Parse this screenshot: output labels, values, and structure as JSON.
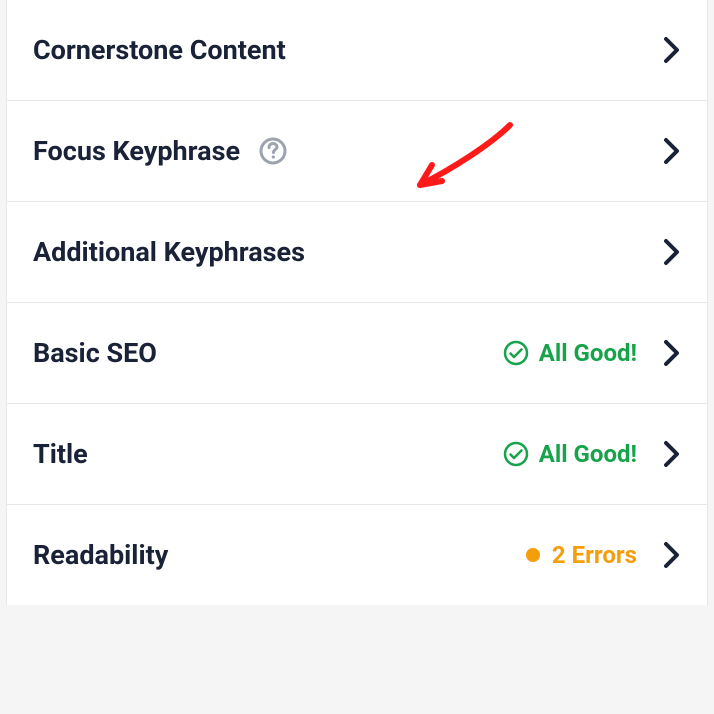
{
  "items": [
    {
      "label": "Cornerstone Content",
      "has_help": false
    },
    {
      "label": "Focus Keyphrase",
      "has_help": true
    },
    {
      "label": "Additional Keyphrases",
      "has_help": false
    },
    {
      "label": "Basic SEO",
      "has_help": false,
      "status": {
        "type": "good",
        "text": "All Good!"
      }
    },
    {
      "label": "Title",
      "has_help": false,
      "status": {
        "type": "good",
        "text": "All Good!"
      }
    },
    {
      "label": "Readability",
      "has_help": false,
      "status": {
        "type": "warn",
        "text": "2 Errors"
      }
    }
  ],
  "colors": {
    "text": "#1a2238",
    "good": "#16a34a",
    "warn": "#f59e0b",
    "help_icon": "#9ca3af",
    "chevron": "#1a2238",
    "border": "#e5e7eb"
  }
}
